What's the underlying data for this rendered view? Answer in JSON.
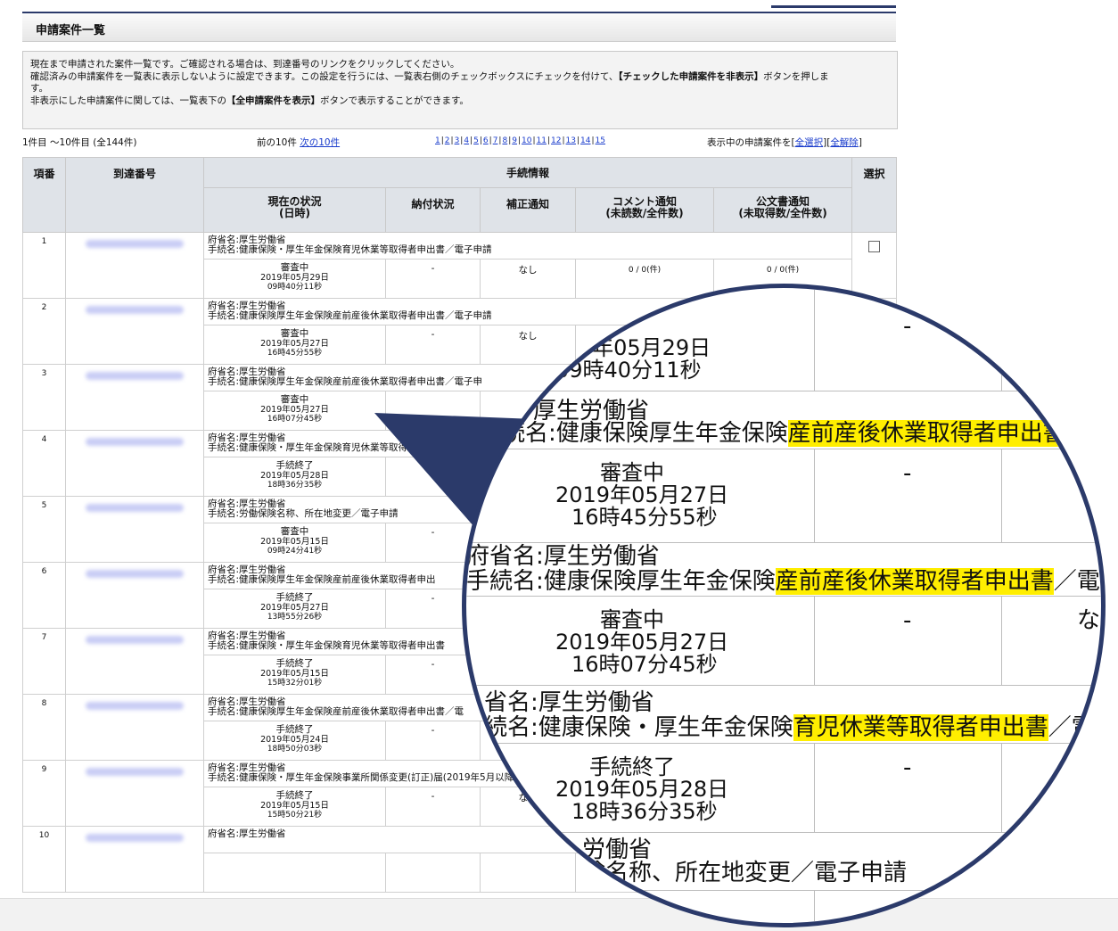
{
  "title": "申請案件一覧",
  "info_lines": [
    "現在まで申請された案件一覧です。ご確認される場合は、到達番号のリンクをクリックしてください。",
    "確認済みの申請案件を一覧表に表示しないように設定できます。この設定を行うには、一覧表右側のチェックボックスにチェックを付けて、",
    "【チェックした申請案件を非表示】",
    "ボタンを押しま",
    "す。",
    "非表示にした申請案件に関しては、一覧表下の",
    "【全申請案件を表示】",
    "ボタンで表示することができます。"
  ],
  "range_text": "1件目 ～10件目 (全144件)",
  "prev_label": "前の10件",
  "next_label": "次の10件",
  "pages": [
    "1",
    "2",
    "3",
    "4",
    "5",
    "6",
    "7",
    "8",
    "9",
    "10",
    "11",
    "12",
    "13",
    "14",
    "15"
  ],
  "select_prefix": "表示中の申請案件を[",
  "select_all": "全選択",
  "select_mid": "][",
  "deselect_all": "全解除",
  "select_suffix": "]",
  "headers": {
    "index": "項番",
    "arrival": "到達番号",
    "procedure": "手続情報",
    "select": "選択",
    "status": "現在の状況",
    "status_sub": "(日時)",
    "payment": "納付状況",
    "correction": "補正通知",
    "comment": "コメント通知",
    "comment_sub": "(未読数/全件数)",
    "official": "公文書通知",
    "official_sub": "(未取得数/全件数)"
  },
  "rows": [
    {
      "no": "1",
      "ministry": "府省名:厚生労働省",
      "procedure": "手続名:健康保険・厚生年金保険育児休業等取得者申出書／電子申請",
      "status": "審査中",
      "date": "2019年05月29日",
      "time": "09時40分11秒",
      "payment": "-",
      "correction": "なし",
      "comment": "0 / 0(件)",
      "official": "0 / 0(件)"
    },
    {
      "no": "2",
      "ministry": "府省名:厚生労働省",
      "procedure": "手続名:健康保険厚生年金保険産前産後休業取得者申出書／電子申請",
      "status": "審査中",
      "date": "2019年05月27日",
      "time": "16時45分55秒",
      "payment": "-",
      "correction": "なし",
      "comment": "",
      "official": ""
    },
    {
      "no": "3",
      "ministry": "府省名:厚生労働省",
      "procedure": "手続名:健康保険厚生年金保険産前産後休業取得者申出書／電子申",
      "status": "審査中",
      "date": "2019年05月27日",
      "time": "16時07分45秒",
      "payment": "",
      "correction": "",
      "comment": "",
      "official": ""
    },
    {
      "no": "4",
      "ministry": "府省名:厚生労働省",
      "procedure": "手続名:健康保険・厚生年金保険育児休業等取得者申出書／電子",
      "status": "手続終了",
      "date": "2019年05月28日",
      "time": "18時36分35秒",
      "payment": "-",
      "correction": "",
      "comment": "",
      "official": ""
    },
    {
      "no": "5",
      "ministry": "府省名:厚生労働省",
      "procedure": "手続名:労働保険名称、所在地変更／電子申請",
      "status": "審査中",
      "date": "2019年05月15日",
      "time": "09時24分41秒",
      "payment": "-",
      "correction": "",
      "comment": "",
      "official": ""
    },
    {
      "no": "6",
      "ministry": "府省名:厚生労働省",
      "procedure": "手続名:健康保険厚生年金保険産前産後休業取得者申出",
      "status": "手続終了",
      "date": "2019年05月27日",
      "time": "13時55分26秒",
      "payment": "-",
      "correction": "",
      "comment": "",
      "official": ""
    },
    {
      "no": "7",
      "ministry": "府省名:厚生労働省",
      "procedure": "手続名:健康保険・厚生年金保険育児休業等取得者申出書",
      "status": "手続終了",
      "date": "2019年05月15日",
      "time": "15時32分01秒",
      "payment": "-",
      "correction": "",
      "comment": "",
      "official": ""
    },
    {
      "no": "8",
      "ministry": "府省名:厚生労働省",
      "procedure": "手続名:健康保険厚生年金保険産前産後休業取得者申出書／電",
      "status": "手続終了",
      "date": "2019年05月24日",
      "time": "18時50分03秒",
      "payment": "-",
      "correction": "",
      "comment": "",
      "official": ""
    },
    {
      "no": "9",
      "ministry": "府省名:厚生労働省",
      "procedure": "手続名:健康保険・厚生年金保険事業所関係変更(訂正)届(2019年5月以降",
      "status": "手続終了",
      "date": "2019年05月15日",
      "time": "15時50分21秒",
      "payment": "-",
      "correction": "なし",
      "comment": "",
      "official": ""
    },
    {
      "no": "10",
      "ministry": "府省名:厚生労働省",
      "procedure": "",
      "status": "",
      "date": "",
      "time": "",
      "payment": "",
      "correction": "",
      "comment": "",
      "official": ""
    }
  ],
  "zoom": {
    "row1_status_date": "2019年05月29日",
    "row1_status_time": "09時40分11秒",
    "row2_ministry": "厚生労働省",
    "row2_proc_pre": "続名:健康保険厚生年金保険",
    "row2_proc_hl": "産前産後休業取得者申出書",
    "row2_proc_post": "／電子",
    "row2_status": "審査中",
    "row2_date": "2019年05月27日",
    "row2_time": "16時45分55秒",
    "row2_dash": "-",
    "row3_ministry": "府省名:厚生労働省",
    "row3_proc_pre": "手続名:健康保険厚生年金保険",
    "row3_proc_hl": "産前産後休業取得者申出書",
    "row3_proc_post": "／電子申請",
    "row3_status": "審査中",
    "row3_date": "2019年05月27日",
    "row3_time": "16時07分45秒",
    "row3_dash": "-",
    "row3_nashi": "なし",
    "row4_ministry": "省名:厚生労働省",
    "row4_proc_pre": "続名:健康保険・厚生年金保険",
    "row4_proc_hl": "育児休業等取得者申出書",
    "row4_proc_post": "／電子申請",
    "row4_status": "手続終了",
    "row4_date": "2019年05月28日",
    "row4_time": "18時36分35秒",
    "row4_dash": "-",
    "row5_ministry": "労働省",
    "row5_proc": "険名称、所在地変更／電子申請",
    "row1_dash": "-"
  },
  "colors": {
    "navy": "#2b3a6a",
    "highlight": "#ffee00",
    "link": "#1a3ccc",
    "header_bg": "#dfe3e8"
  }
}
